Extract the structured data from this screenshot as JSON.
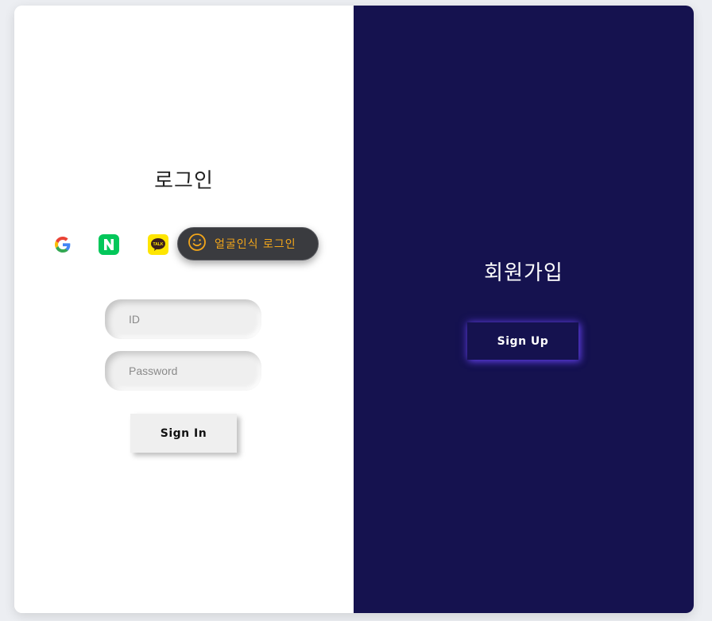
{
  "login": {
    "title": "로그인",
    "face_login_label": "얼굴인식 로그인",
    "id_placeholder": "ID",
    "password_placeholder": "Password",
    "signin_label": "Sign In",
    "icons": [
      "google-icon",
      "naver-icon",
      "kakao-talk-icon",
      "smiley-face-icon"
    ]
  },
  "signup": {
    "title": "회원가입",
    "signup_label": "Sign Up"
  },
  "colors": {
    "panel_dark": "#15124f",
    "face_accent": "#f3a61a",
    "naver_green": "#03c75a",
    "kakao_yellow": "#fee500"
  }
}
